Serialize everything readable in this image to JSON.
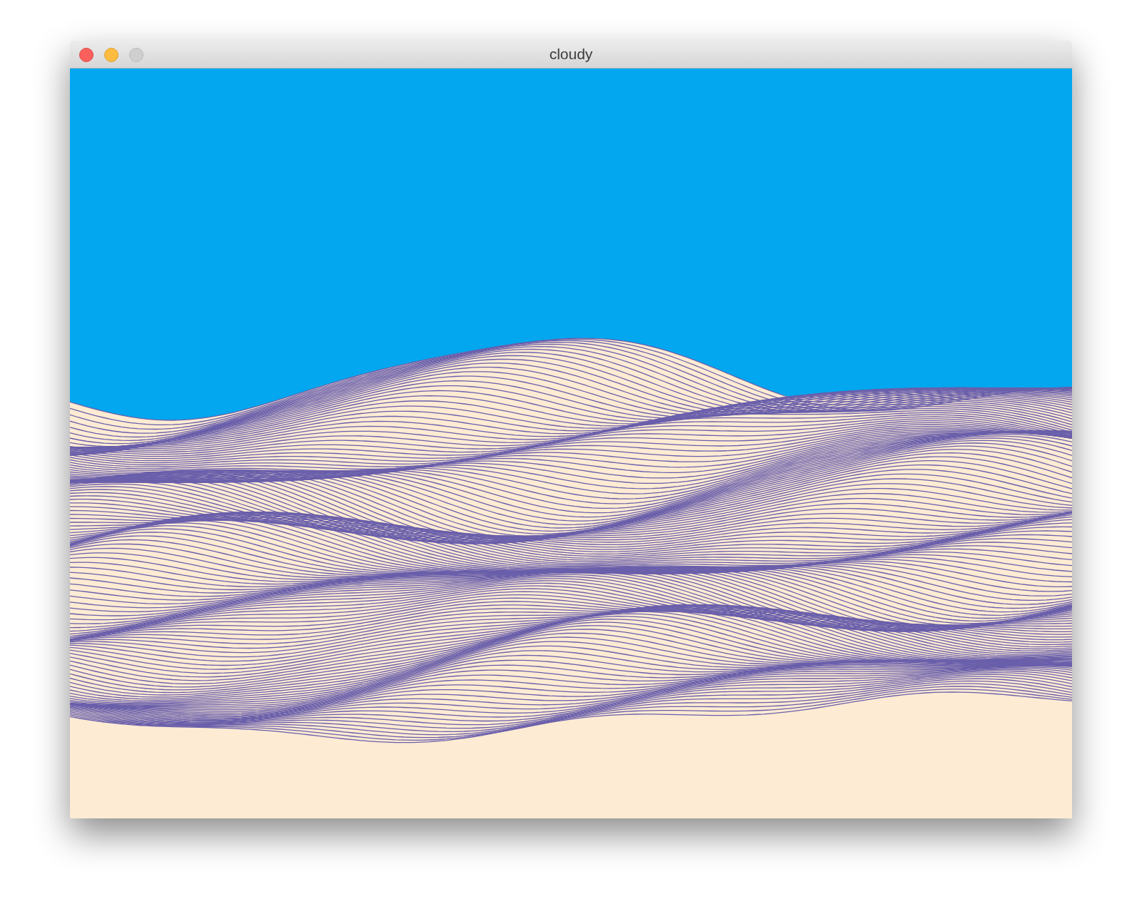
{
  "window": {
    "title": "cloudy",
    "controls": [
      {
        "kind": "close",
        "disabled": false
      },
      {
        "kind": "minimize",
        "disabled": false
      },
      {
        "kind": "zoom",
        "disabled": true
      }
    ]
  }
}
